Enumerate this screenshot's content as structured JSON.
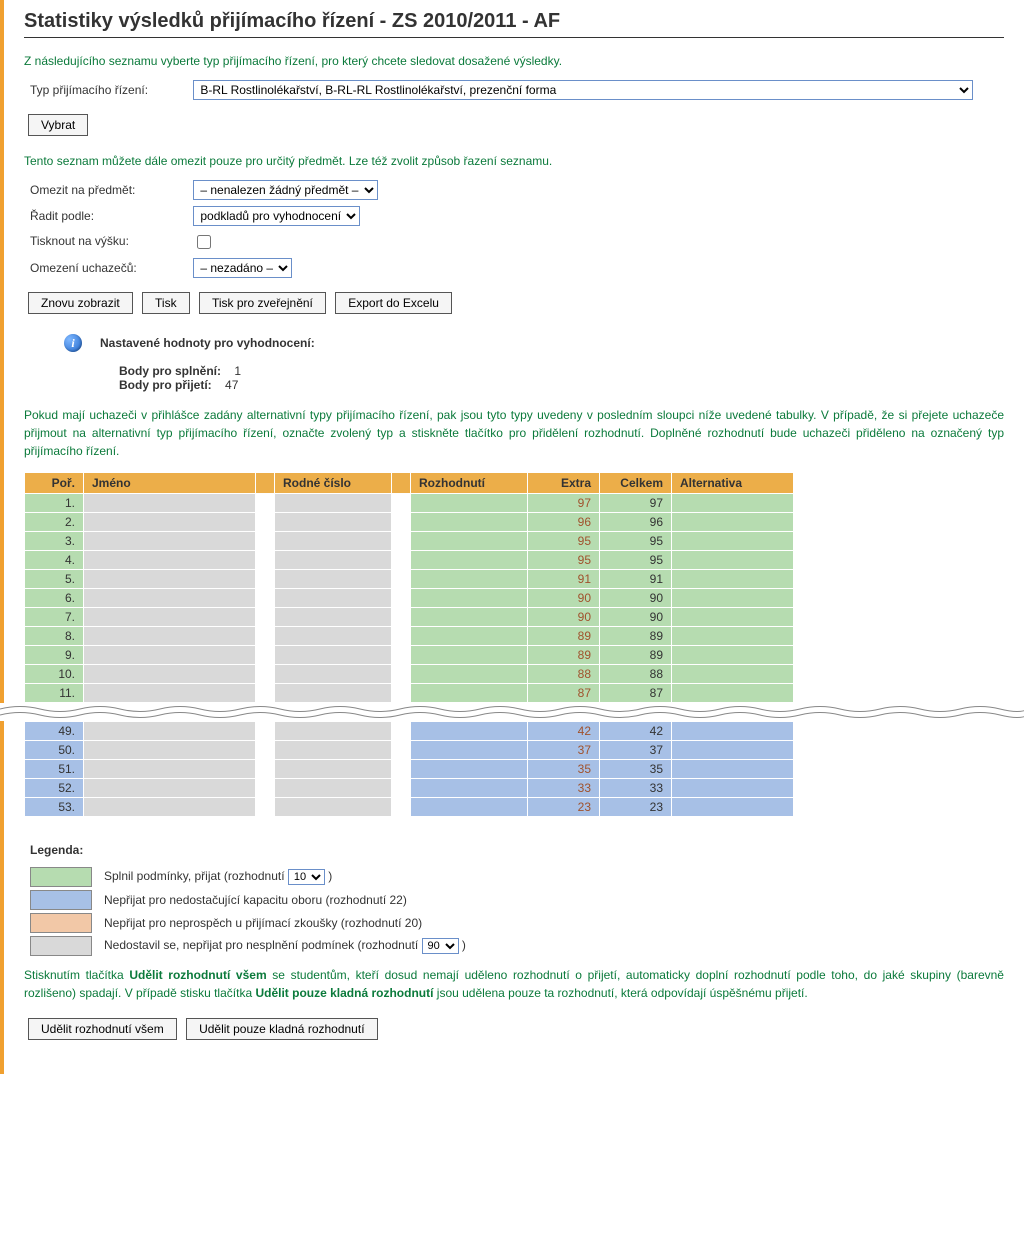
{
  "title": "Statistiky výsledků přijímacího řízení - ZS 2010/2011 - AF",
  "intro": "Z následujícího seznamu vyberte typ přijímacího řízení, pro který chcete sledovat dosažené výsledky.",
  "typ_label": "Typ přijímacího řízení:",
  "typ_value": "B-RL Rostlinolékařství, B-RL-RL Rostlinolékařství, prezenční forma",
  "vybrat_label": "Vybrat",
  "note1": "Tento seznam můžete dále omezit pouze pro určitý předmět. Lze též zvolit způsob řazení seznamu.",
  "labels": {
    "omezit_predmet": "Omezit na předmět:",
    "radit": "Řadit podle:",
    "tisk_vysku": "Tisknout na výšku:",
    "omezeni_uch": "Omezení uchazečů:"
  },
  "selects": {
    "omezit_predmet": "– nenalezen žádný předmět –",
    "radit": "podkladů pro vyhodnocení",
    "omezeni_uch": "– nezadáno –"
  },
  "buttons": {
    "znovu": "Znovu zobrazit",
    "tisk": "Tisk",
    "tisk_zverejneni": "Tisk pro zveřejnění",
    "export": "Export do Excelu",
    "udelit_vsem": "Udělit rozhodnutí všem",
    "udelit_kladna": "Udělit pouze kladná rozhodnutí"
  },
  "info": {
    "heading": "Nastavené hodnoty pro vyhodnocení:",
    "splneni_label": "Body pro splnění:",
    "splneni_value": "1",
    "prijeti_label": "Body pro přijetí:",
    "prijeti_value": "47"
  },
  "note2": "Pokud mají uchazeči v přihlášce zadány alternativní typy přijímacího řízení, pak jsou tyto typy uvedeny v posledním sloupci níže uvedené tabulky. V případě, že si přejete uchazeče přijmout na alternativní typ přijímacího řízení, označte zvolený typ a stiskněte tlačítko pro přidělení rozhodnutí. Doplněné rozhodnutí bude uchazeči přiděleno na označený typ přijímacího řízení.",
  "table": {
    "headers": {
      "por": "Poř.",
      "jmeno": "Jméno",
      "rc": "Rodné číslo",
      "roz": "Rozhodnutí",
      "extra": "Extra",
      "celkem": "Celkem",
      "alt": "Alternativa"
    },
    "top_rows": [
      {
        "por": "1.",
        "extra": "97",
        "celkem": "97"
      },
      {
        "por": "2.",
        "extra": "96",
        "celkem": "96"
      },
      {
        "por": "3.",
        "extra": "95",
        "celkem": "95"
      },
      {
        "por": "4.",
        "extra": "95",
        "celkem": "95"
      },
      {
        "por": "5.",
        "extra": "91",
        "celkem": "91"
      },
      {
        "por": "6.",
        "extra": "90",
        "celkem": "90"
      },
      {
        "por": "7.",
        "extra": "90",
        "celkem": "90"
      },
      {
        "por": "8.",
        "extra": "89",
        "celkem": "89"
      },
      {
        "por": "9.",
        "extra": "89",
        "celkem": "89"
      },
      {
        "por": "10.",
        "extra": "88",
        "celkem": "88"
      },
      {
        "por": "11.",
        "extra": "87",
        "celkem": "87"
      }
    ],
    "bottom_rows": [
      {
        "por": "49.",
        "extra": "42",
        "celkem": "42"
      },
      {
        "por": "50.",
        "extra": "37",
        "celkem": "37"
      },
      {
        "por": "51.",
        "extra": "35",
        "celkem": "35"
      },
      {
        "por": "52.",
        "extra": "33",
        "celkem": "33"
      },
      {
        "por": "53.",
        "extra": "23",
        "celkem": "23"
      }
    ]
  },
  "legend": {
    "title": "Legenda:",
    "green_pre": "Splnil podmínky, přijat (rozhodnutí ",
    "green_sel": "10",
    "close_paren": ")",
    "blue": "Nepřijat pro nedostačující kapacitu oboru (rozhodnutí 22)",
    "orange": "Nepřijat pro neprospěch u přijímací zkoušky (rozhodnutí 20)",
    "grey_pre": "Nedostavil se, nepřijat pro nesplnění podmínek (rozhodnutí ",
    "grey_sel": "90"
  },
  "note3_parts": {
    "a": "Stisknutím tlačítka ",
    "b1": "Udělit rozhodnutí všem",
    "c": " se studentům, kteří dosud nemají uděleno rozhodnutí o přijetí, automaticky doplní rozhodnutí podle toho, do jaké skupiny (barevně rozlišeno) spadají. V případě stisku tlačítka ",
    "b2": "Udělit pouze kladná rozhodnutí",
    "d": " jsou udělena pouze ta rozhodnutí, která odpovídají úspěšnému přijetí."
  }
}
